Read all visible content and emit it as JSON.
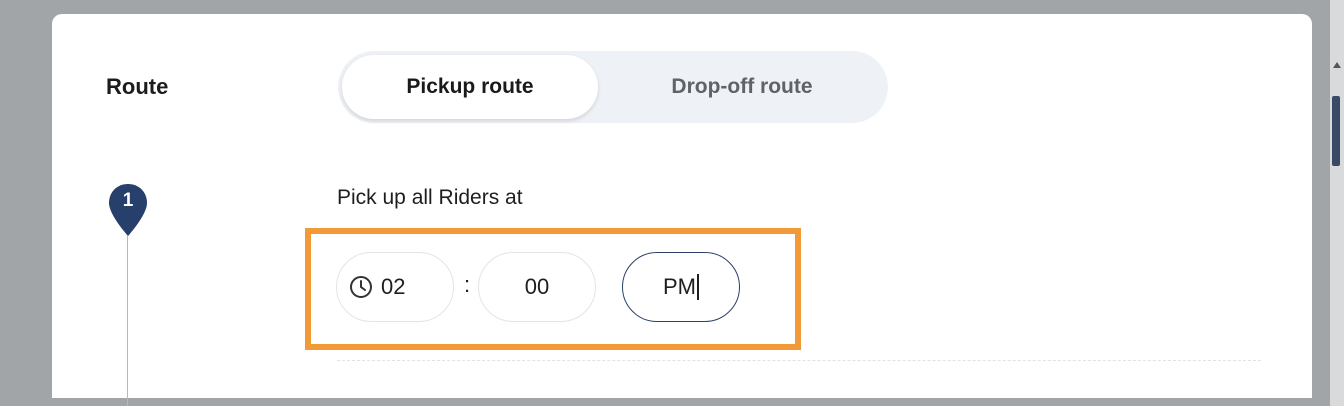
{
  "route": {
    "label": "Route",
    "tabs": [
      {
        "label": "Pickup route",
        "active": true
      },
      {
        "label": "Drop-off route",
        "active": false
      }
    ]
  },
  "step": {
    "number": "1",
    "title": "Pick up all Riders at"
  },
  "time": {
    "hour": "02",
    "separator": ":",
    "minute": "00",
    "period": "PM"
  },
  "colors": {
    "accent_highlight": "#f29a38",
    "pin": "#26406b",
    "active_field_border": "#2a4066"
  },
  "icons": {
    "clock": "clock-icon",
    "pin": "map-pin-icon"
  }
}
